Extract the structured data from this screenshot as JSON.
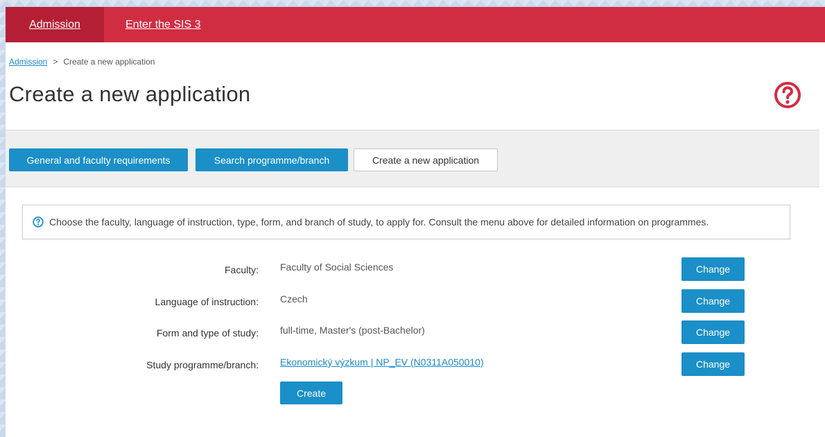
{
  "topnav": {
    "admission": "Admission",
    "enter_sis": "Enter the SIS 3"
  },
  "breadcrumb": {
    "root": "Admission",
    "separator": ">",
    "current": "Create a new application"
  },
  "page_title": "Create a new application",
  "help_icon": "question-circle-icon",
  "tabs": [
    {
      "label": "General and faculty requirements",
      "style": "blue"
    },
    {
      "label": "Search programme/branch",
      "style": "blue"
    },
    {
      "label": "Create a new application",
      "style": "white"
    }
  ],
  "info": {
    "icon": "question-circle-icon",
    "text": "Choose the faculty, language of instruction, type, form, and branch of study, to apply for. Consult the menu above for detailed information on programmes."
  },
  "form": {
    "rows": [
      {
        "label": "Faculty:",
        "value": "Faculty of Social Sciences",
        "button": "Change"
      },
      {
        "label": "Language of instruction:",
        "value": "Czech",
        "button": "Change"
      },
      {
        "label": "Form and type of study:",
        "value": "full-time, Master's (post-Bachelor)",
        "button": "Change"
      },
      {
        "label": "Study programme/branch:",
        "value": "Ekonomický výzkum | NP_EV (N0311A050010)",
        "button": "Change"
      }
    ],
    "create_label": "Create"
  },
  "colors": {
    "nav_red": "#d12d42",
    "nav_active": "#b51f36",
    "button_blue": "#1b8fc7",
    "link_blue": "#1a8ac6",
    "help_red": "#d12d42"
  }
}
